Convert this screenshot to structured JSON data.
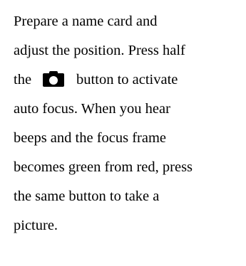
{
  "instructions": {
    "line1": "Prepare a name card and",
    "line2": "adjust the position. Press half",
    "line3_before": "the",
    "line3_icon": "camera-shutter-icon",
    "line3_after": "button to activate",
    "line4": "auto focus. When you hear",
    "line5": "beeps and the focus frame",
    "line6": "becomes green from red, press",
    "line7": "the same button to take a",
    "line8": "picture."
  }
}
